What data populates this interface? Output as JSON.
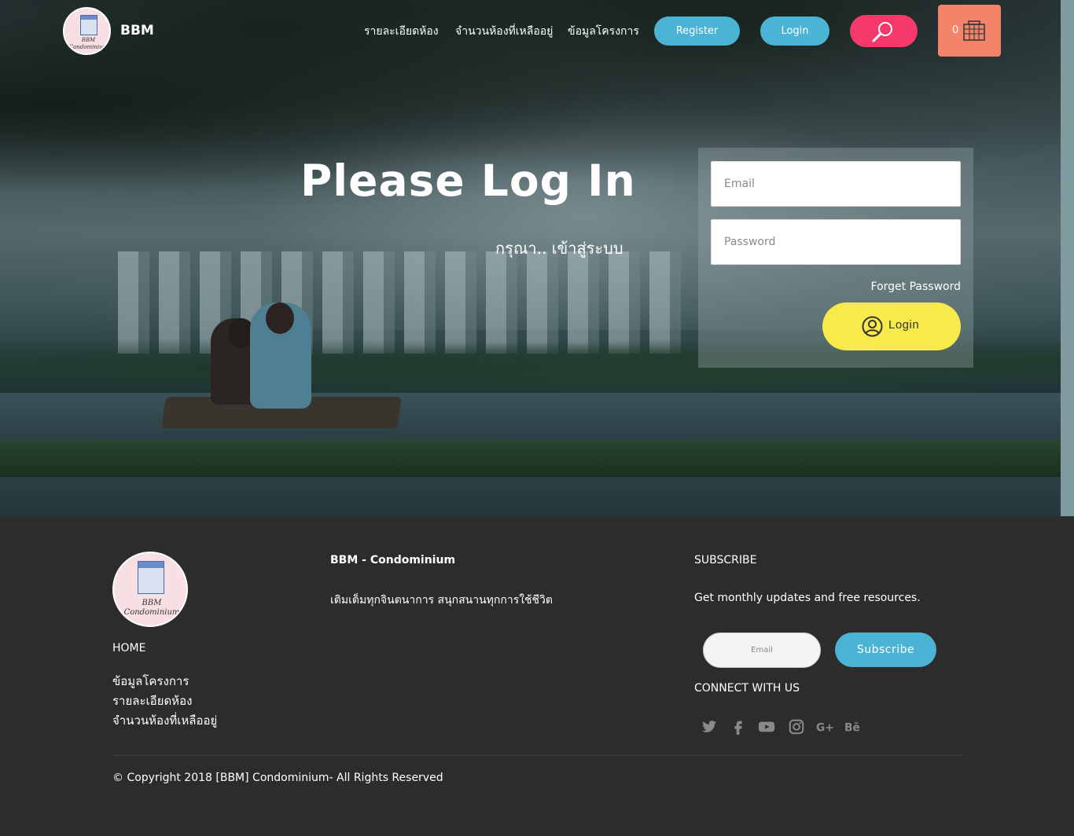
{
  "header": {
    "brand": "BBM",
    "logo_text": "BBM Condominium",
    "nav": [
      "รายละเอียดห้อง",
      "จำนวนห้องที่เหลืออยู่",
      "ข้อมูลโครงการ"
    ],
    "register_label": "Register",
    "login_label": "Login",
    "cart_count": "0"
  },
  "hero": {
    "title": "Please Log In",
    "subtitle": "กรุณา.. เข้าสู่ระบบ"
  },
  "login_form": {
    "email_placeholder": "Email",
    "password_placeholder": "Password",
    "forget_label": "Forget Password",
    "login_label": "Login"
  },
  "footer": {
    "home_label": "HOME",
    "links": [
      "ข้อมูลโครงการ",
      "รายละเอียดห้อง",
      "จำนวนห้องที่เหลืออยู่"
    ],
    "about_title": "BBM - Condominium",
    "about_text": "เติมเต็มทุกจินตนาการ สนุกสนานทุกการใช้ชีวิต",
    "subscribe_title": "SUBSCRIBE",
    "subscribe_text": "Get monthly updates and free resources.",
    "subscribe_placeholder": "Email",
    "subscribe_button": "Subscribe",
    "connect_title": "CONNECT WITH US",
    "socials": [
      "twitter-icon",
      "facebook-icon",
      "youtube-icon",
      "instagram-icon",
      "google-plus-icon",
      "behance-icon"
    ],
    "copyright": "© Copyright 2018 [BBM] Condominium- All Rights Reserved"
  },
  "colors": {
    "accent_blue": "#4bb3d3",
    "search_pink": "#f53a6b",
    "cart_orange": "#f3846a",
    "login_yellow": "#f7ea4a",
    "footer_bg": "#2c2c2c"
  }
}
